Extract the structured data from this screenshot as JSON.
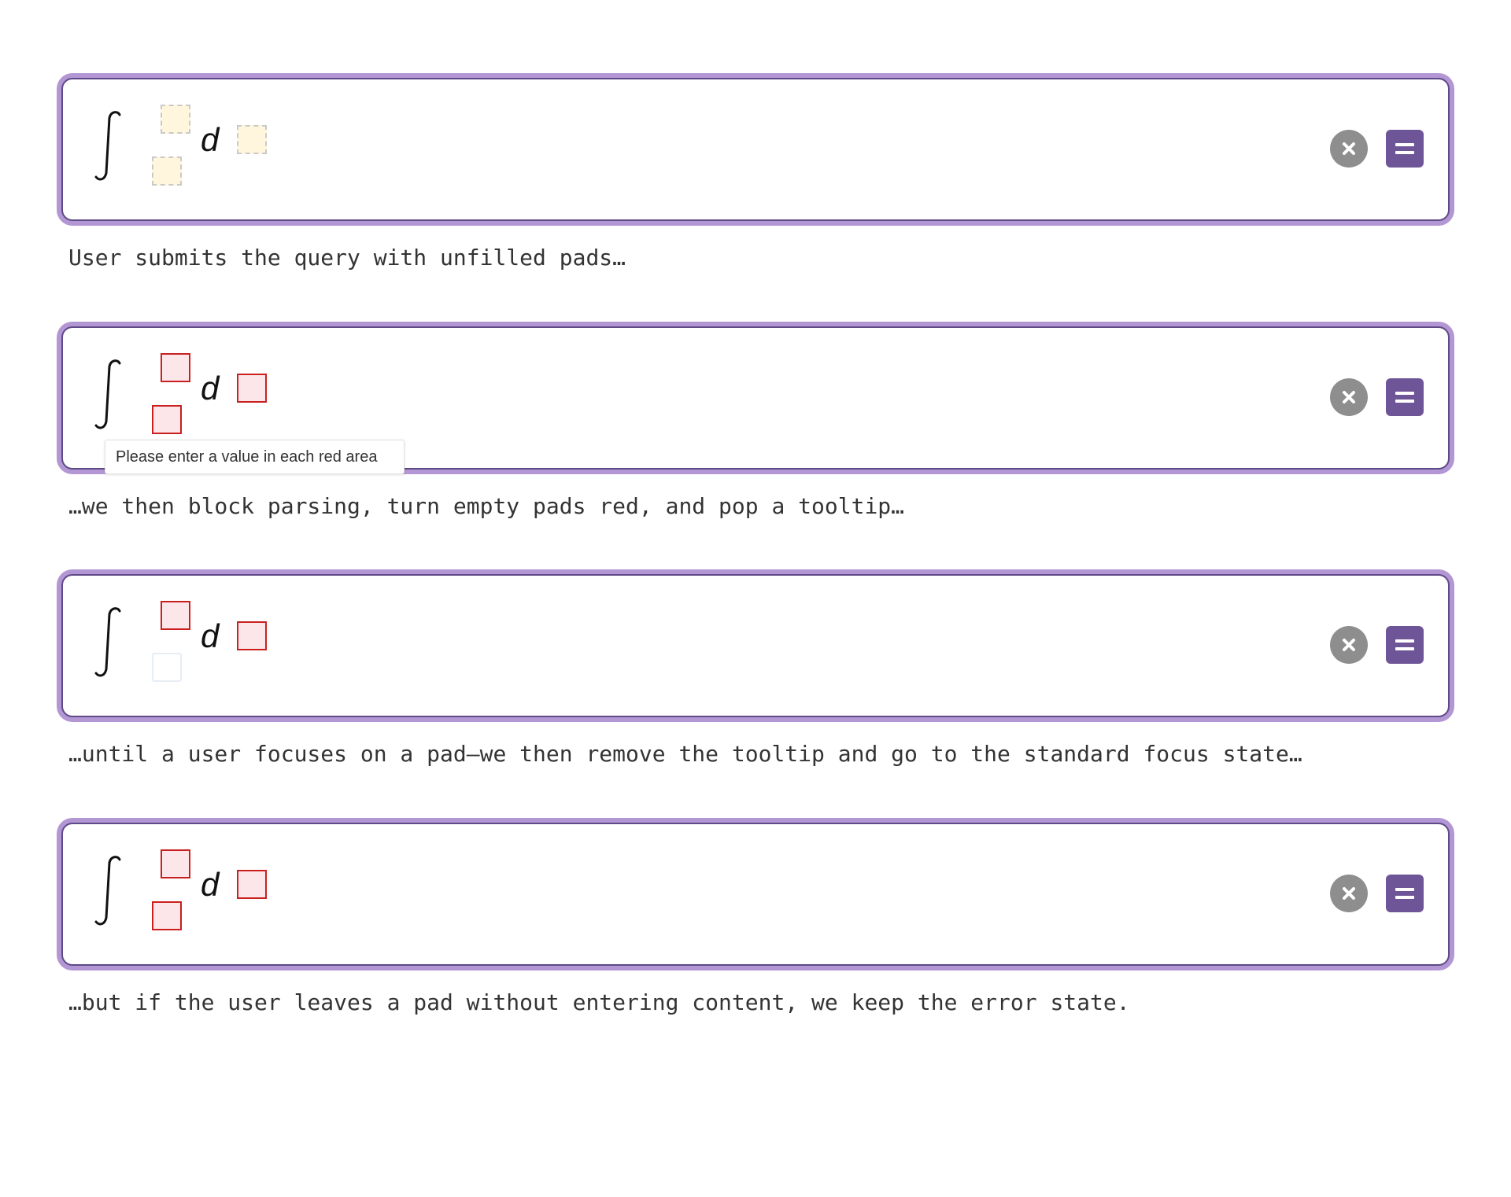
{
  "states": [
    {
      "math": {
        "d_symbol": "d"
      },
      "captions": {
        "text": "User submits the query with unfilled pads…"
      }
    },
    {
      "math": {
        "d_symbol": "d"
      },
      "tooltip": {
        "text": "Please enter a value in each red area"
      },
      "captions": {
        "text": "…we then block parsing, turn empty pads red, and pop a tooltip…"
      }
    },
    {
      "math": {
        "d_symbol": "d"
      },
      "captions": {
        "text": "…until a user focuses on a pad—we then remove the tooltip and go to the standard focus state…"
      }
    },
    {
      "math": {
        "d_symbol": "d"
      },
      "captions": {
        "text": "…but if the user leaves a pad without entering content, we keep the error state."
      }
    }
  ],
  "icons": {
    "clear": "close-icon",
    "submit": "equals-icon"
  },
  "colors": {
    "focus_ring": "#b396d4",
    "box_border": "#5e4a86",
    "equals_button": "#6e5597",
    "clear_button": "#8e8e8e",
    "empty_pad": "#fff6dd",
    "error_pad_fill": "#fde6ea",
    "error_pad_border": "#c9201e"
  }
}
